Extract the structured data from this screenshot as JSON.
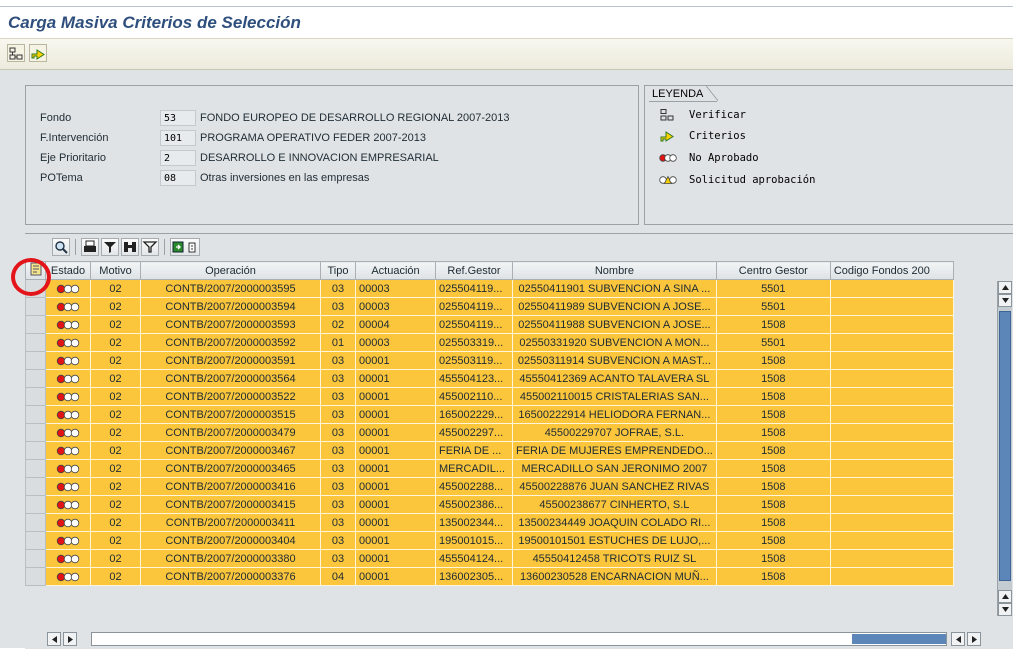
{
  "window": {
    "title": "Carga Masiva Criterios de Selección"
  },
  "toolbar": {
    "buttons": [
      {
        "icon": "verificar-icon"
      },
      {
        "icon": "criterios-icon"
      }
    ]
  },
  "header": {
    "fields": [
      {
        "label": "Fondo",
        "code": "53",
        "desc": "FONDO EUROPEO DE DESARROLLO REGIONAL 2007-2013"
      },
      {
        "label": "F.Intervención",
        "code": "101",
        "desc": "PROGRAMA OPERATIVO FEDER 2007-2013"
      },
      {
        "label": "Eje Prioritario",
        "code": "2",
        "desc": "DESARROLLO E INNOVACION EMPRESARIAL"
      },
      {
        "label": "POTema",
        "code": "08",
        "desc": "Otras inversiones en las empresas"
      }
    ]
  },
  "legend": {
    "title": "LEYENDA",
    "items": [
      {
        "icon": "verificar-icon",
        "text": "Verificar"
      },
      {
        "icon": "criterios-icon",
        "text": "Criterios"
      },
      {
        "icon": "red-traffic-light-icon",
        "text": "No Aprobado"
      },
      {
        "icon": "yellow-traffic-light-icon",
        "text": "Solicitud aprobación"
      }
    ]
  },
  "grid": {
    "columns": [
      "Estado",
      "Motivo",
      "Operación",
      "Tipo",
      "Actuación",
      "Ref.Gestor",
      "Nombre",
      "Centro Gestor",
      "Codigo Fondos 200"
    ],
    "rows": [
      {
        "motivo": "02",
        "operacion": "CONTB/2007/2000003595",
        "tipo": "03",
        "actuacion": "00003",
        "ref": "025504119...",
        "nombre": "02550411901 SUBVENCION A SINA ...",
        "centro": "5501"
      },
      {
        "motivo": "02",
        "operacion": "CONTB/2007/2000003594",
        "tipo": "03",
        "actuacion": "00003",
        "ref": "025504119...",
        "nombre": "02550411989 SUBVENCION A JOSE...",
        "centro": "5501"
      },
      {
        "motivo": "02",
        "operacion": "CONTB/2007/2000003593",
        "tipo": "02",
        "actuacion": "00004",
        "ref": "025504119...",
        "nombre": "02550411988 SUBVENCION A JOSE...",
        "centro": "1508"
      },
      {
        "motivo": "02",
        "operacion": "CONTB/2007/2000003592",
        "tipo": "01",
        "actuacion": "00003",
        "ref": "025503319...",
        "nombre": "02550331920 SUBVENCION A MON...",
        "centro": "5501"
      },
      {
        "motivo": "02",
        "operacion": "CONTB/2007/2000003591",
        "tipo": "03",
        "actuacion": "00001",
        "ref": "025503119...",
        "nombre": "02550311914 SUBVENCION A MAST...",
        "centro": "1508"
      },
      {
        "motivo": "02",
        "operacion": "CONTB/2007/2000003564",
        "tipo": "03",
        "actuacion": "00001",
        "ref": "455504123...",
        "nombre": "45550412369 ACANTO TALAVERA SL",
        "centro": "1508"
      },
      {
        "motivo": "02",
        "operacion": "CONTB/2007/2000003522",
        "tipo": "03",
        "actuacion": "00001",
        "ref": "455002110...",
        "nombre": "455002110015 CRISTALERIAS SAN...",
        "centro": "1508"
      },
      {
        "motivo": "02",
        "operacion": "CONTB/2007/2000003515",
        "tipo": "03",
        "actuacion": "00001",
        "ref": "165002229...",
        "nombre": "16500222914 HELIODORA FERNAN...",
        "centro": "1508"
      },
      {
        "motivo": "02",
        "operacion": "CONTB/2007/2000003479",
        "tipo": "03",
        "actuacion": "00001",
        "ref": "455002297...",
        "nombre": "45500229707 JOFRAE, S.L.",
        "centro": "1508"
      },
      {
        "motivo": "02",
        "operacion": "CONTB/2007/2000003467",
        "tipo": "03",
        "actuacion": "00001",
        "ref": "FERIA DE ...",
        "nombre": "FERIA DE MUJERES EMPRENDEDO...",
        "centro": "1508"
      },
      {
        "motivo": "02",
        "operacion": "CONTB/2007/2000003465",
        "tipo": "03",
        "actuacion": "00001",
        "ref": "MERCADIL...",
        "nombre": "MERCADILLO SAN JERONIMO 2007",
        "centro": "1508"
      },
      {
        "motivo": "02",
        "operacion": "CONTB/2007/2000003416",
        "tipo": "03",
        "actuacion": "00001",
        "ref": "455002288...",
        "nombre": "45500228876 JUAN SANCHEZ RIVAS",
        "centro": "1508"
      },
      {
        "motivo": "02",
        "operacion": "CONTB/2007/2000003415",
        "tipo": "03",
        "actuacion": "00001",
        "ref": "455002386...",
        "nombre": "45500238677 CINHERTO, S.L",
        "centro": "1508"
      },
      {
        "motivo": "02",
        "operacion": "CONTB/2007/2000003411",
        "tipo": "03",
        "actuacion": "00001",
        "ref": "135002344...",
        "nombre": "13500234449 JOAQUIN COLADO RI...",
        "centro": "1508"
      },
      {
        "motivo": "02",
        "operacion": "CONTB/2007/2000003404",
        "tipo": "03",
        "actuacion": "00001",
        "ref": "195001015...",
        "nombre": "19500101501 ESTUCHES DE LUJO,...",
        "centro": "1508"
      },
      {
        "motivo": "02",
        "operacion": "CONTB/2007/2000003380",
        "tipo": "03",
        "actuacion": "00001",
        "ref": "455504124...",
        "nombre": "45550412458 TRICOTS RUIZ SL",
        "centro": "1508"
      },
      {
        "motivo": "02",
        "operacion": "CONTB/2007/2000003376",
        "tipo": "04",
        "actuacion": "00001",
        "ref": "136002305...",
        "nombre": "13600230528 ENCARNACION MUÑ...",
        "centro": "1508"
      }
    ]
  },
  "colors": {
    "row_bg": "#fcc63c",
    "title": "#2e4f7d",
    "highlight_circle": "#e3151a"
  }
}
